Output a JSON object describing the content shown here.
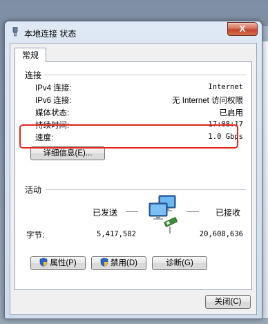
{
  "window": {
    "title": "本地连接 状态",
    "close_label": "X"
  },
  "tab": {
    "label": "常规"
  },
  "connection": {
    "section_title": "连接",
    "rows": [
      {
        "label": "IPv4 连接:",
        "value": "Internet"
      },
      {
        "label": "IPv6 连接:",
        "value": "无 Internet 访问权限"
      },
      {
        "label": "媒体状态:",
        "value": "已启用"
      },
      {
        "label": "持续时间:",
        "value": "17:08:17"
      },
      {
        "label": "速度:",
        "value": "1.0 Gbps"
      }
    ],
    "details_button": "详细信息(E)..."
  },
  "activity": {
    "section_title": "活动",
    "sent_label": "已发送",
    "received_label": "已接收",
    "bytes_label": "字节:",
    "bytes_sent": "5,417,582",
    "bytes_received": "20,608,636"
  },
  "buttons": {
    "properties": "属性(P)",
    "disable": "禁用(D)",
    "diagnose": "诊断(G)",
    "close": "关闭(C)"
  },
  "highlight_color": "#e3241c"
}
